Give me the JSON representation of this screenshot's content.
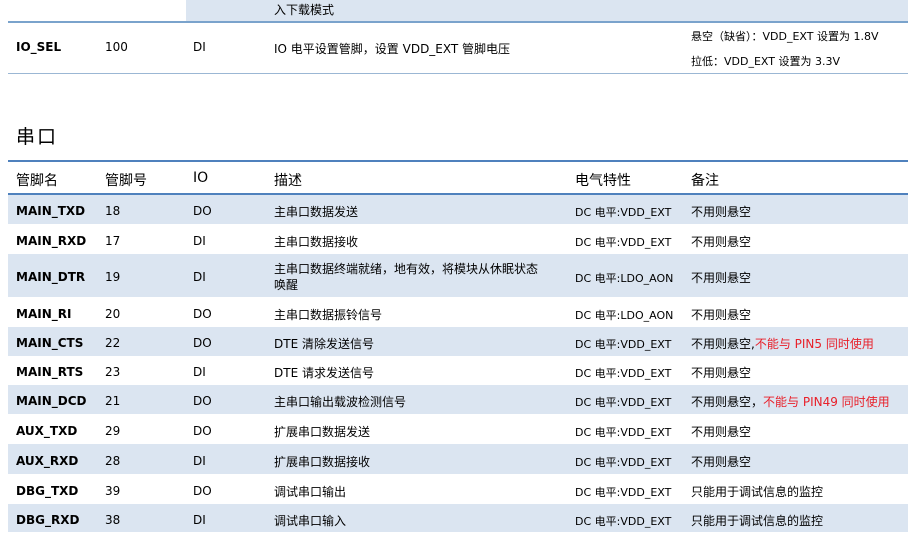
{
  "top": {
    "prev_desc": "入下载模式",
    "io_sel": {
      "name": "IO_SEL",
      "num": "100",
      "io": "DI",
      "desc": "IO 电平设置管脚，设置  VDD_EXT 管脚电压",
      "note_line1": "悬空（缺省）：VDD_EXT 设置为 1.8V",
      "note_line2": "拉低：VDD_EXT 设置为 3.3V"
    }
  },
  "section_title": "串口",
  "table": {
    "headers": {
      "name": "管脚名",
      "num": "管脚号",
      "io": "IO",
      "desc": "描述",
      "elec": "电气特性",
      "note": "备注"
    },
    "rows": [
      {
        "name": "MAIN_TXD",
        "num": "18",
        "io": "DO",
        "desc": "主串口数据发送",
        "elec": "DC 电平:VDD_EXT",
        "note": "不用则悬空",
        "note_red": ""
      },
      {
        "name": "MAIN_RXD",
        "num": "17",
        "io": "DI",
        "desc": "主串口数据接收",
        "elec": "DC 电平:VDD_EXT",
        "note": "不用则悬空",
        "note_red": ""
      },
      {
        "name": "MAIN_DTR",
        "num": "19",
        "io": "DI",
        "desc": "主串口数据终端就绪，地有效，将模块从休眠状态",
        "desc2": "唤醒",
        "elec": "DC 电平:LDO_AON",
        "note": "不用则悬空",
        "note_red": ""
      },
      {
        "name": "MAIN_RI",
        "num": "20",
        "io": "DO",
        "desc": "主串口数据振铃信号",
        "elec": "DC 电平:LDO_AON",
        "note": "不用则悬空",
        "note_red": ""
      },
      {
        "name": "MAIN_CTS",
        "num": "22",
        "io": "DO",
        "desc": "DTE 清除发送信号",
        "elec": "DC 电平:VDD_EXT",
        "note": "不用则悬空,",
        "note_red": "不能与 PIN5 同时使用"
      },
      {
        "name": "MAIN_RTS",
        "num": "23",
        "io": "DI",
        "desc": "DTE 请求发送信号",
        "elec": "DC 电平:VDD_EXT",
        "note": "不用则悬空",
        "note_red": ""
      },
      {
        "name": "MAIN_DCD",
        "num": "21",
        "io": "DO",
        "desc": "主串口输出载波检测信号",
        "elec": "DC 电平:VDD_EXT",
        "note": "不用则悬空，",
        "note_red": "不能与 PIN49 同时使用"
      },
      {
        "name": "AUX_TXD",
        "num": "29",
        "io": "DO",
        "desc": "扩展串口数据发送",
        "elec": "DC 电平:VDD_EXT",
        "note": "不用则悬空",
        "note_red": ""
      },
      {
        "name": "AUX_RXD",
        "num": "28",
        "io": "DI",
        "desc": "扩展串口数据接收",
        "elec": "DC 电平:VDD_EXT",
        "note": "不用则悬空",
        "note_red": ""
      },
      {
        "name": "DBG_TXD",
        "num": "39",
        "io": "DO",
        "desc": "调试串口输出",
        "elec": "DC 电平:VDD_EXT",
        "note": "只能用于调试信息的监控",
        "note_red": ""
      },
      {
        "name": "DBG_RXD",
        "num": "38",
        "io": "DI",
        "desc": "调试串口输入",
        "elec": "DC 电平:VDD_EXT",
        "note": "只能用于调试信息的监控",
        "note_red": ""
      }
    ]
  }
}
